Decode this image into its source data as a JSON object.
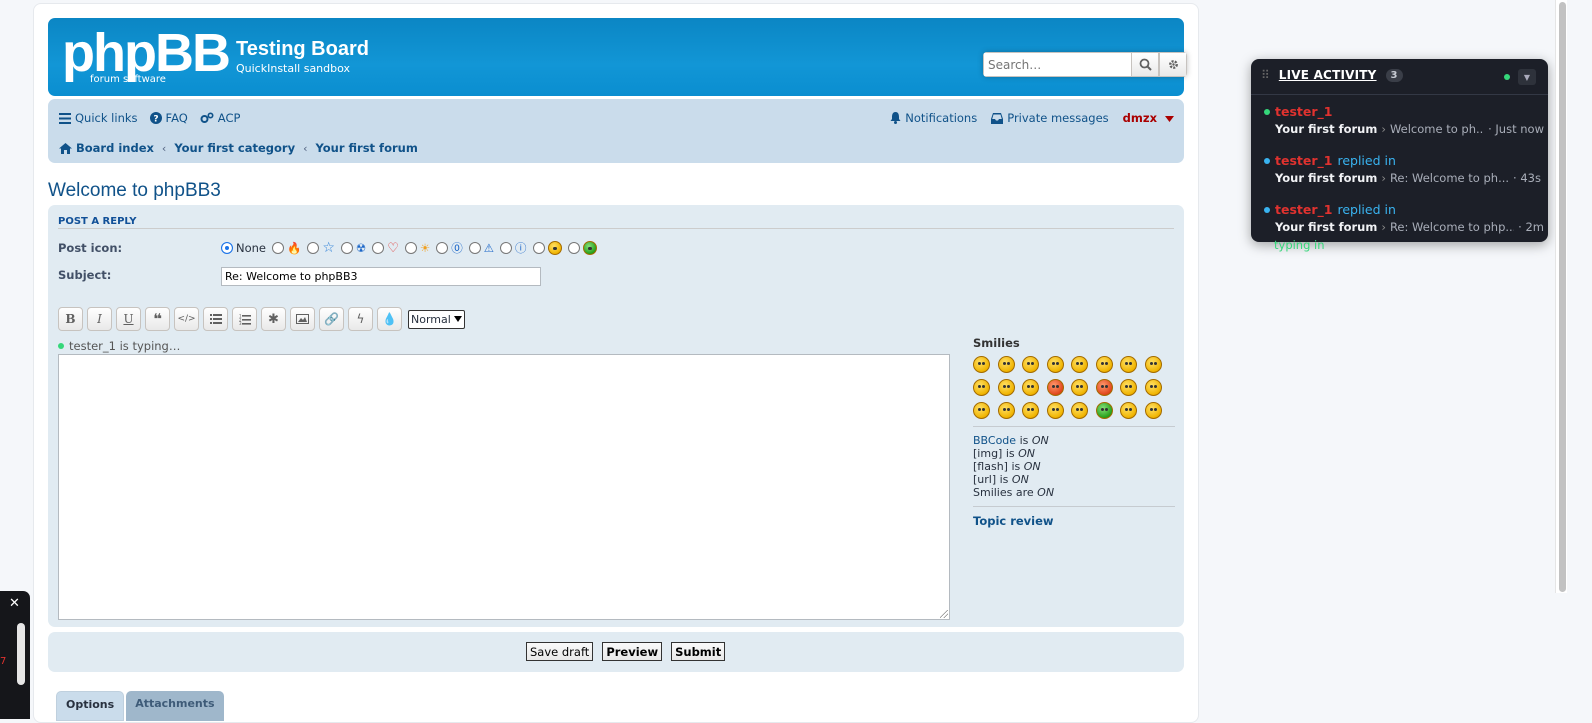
{
  "header": {
    "logo_text": "phpBB",
    "logo_sub": "forum  software",
    "site_title": "Testing Board",
    "site_desc": "QuickInstall sandbox",
    "search_placeholder": "Search…"
  },
  "nav": {
    "quick_links": "Quick links",
    "faq": "FAQ",
    "acp": "ACP",
    "notifications": "Notifications",
    "private_messages": "Private messages",
    "username": "dmzx"
  },
  "breadcrumbs": [
    "Board index",
    "Your first category",
    "Your first forum"
  ],
  "topic_title": "Welcome to phpBB3",
  "post": {
    "section_title": "POST A REPLY",
    "post_icon_label": "Post icon:",
    "post_icon_none": "None",
    "subject_label": "Subject:",
    "subject_value": "Re: Welcome to phpBB3",
    "font_size_value": "Normal",
    "typing_indicator": "tester_1 is typing…",
    "toolbar": [
      "B",
      "I",
      "U",
      "quote",
      "code",
      "list",
      "list-numbered",
      "list-item",
      "img",
      "url",
      "flash",
      "color"
    ]
  },
  "side": {
    "smilies_title": "Smilies",
    "bbcode_link": "BBCode",
    "bbcode_is": "is",
    "bbcode_state": "ON",
    "img_label": "[img] is",
    "img_state": "ON",
    "flash_label": "[flash] is",
    "flash_state": "ON",
    "url_label": "[url] is",
    "url_state": "ON",
    "smilies_label": "Smilies are",
    "smilies_state": "ON",
    "topic_review": "Topic review"
  },
  "buttons": {
    "save_draft": "Save draft",
    "preview": "Preview",
    "submit": "Submit"
  },
  "tabs": [
    "Options",
    "Attachments"
  ],
  "live_activity": {
    "title": "LIVE ACTIVITY",
    "count": "3",
    "items": [
      {
        "user": "tester_1",
        "action": "typing in",
        "forum": "Your first forum",
        "topic": "Welcome to ph...",
        "time": "· Just now",
        "kind": "typing"
      },
      {
        "user": "tester_1",
        "action": "replied in",
        "forum": "Your first forum",
        "topic": "Re: Welcome to ph...",
        "time": "· 43s",
        "kind": "replied"
      },
      {
        "user": "tester_1",
        "action": "replied in",
        "forum": "Your first forum",
        "topic": "Re: Welcome to php...",
        "time": "· 2m",
        "kind": "replied"
      }
    ]
  },
  "colors": {
    "header_blue": "#1296d6",
    "nav_bg": "#cadceb",
    "panel_bg": "#e1ebf2",
    "link": "#105289",
    "username_red": "#aa0000",
    "widget_bg": "#1c1f28",
    "typing_green": "#35d77a",
    "replied_blue": "#39b3f0"
  }
}
